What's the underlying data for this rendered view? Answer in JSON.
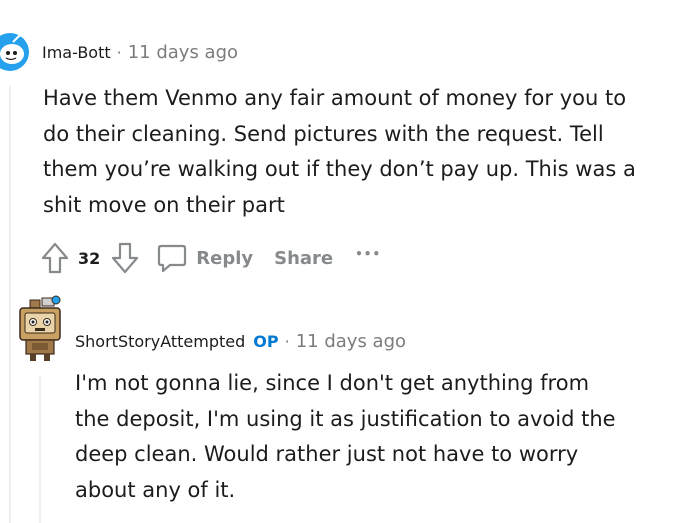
{
  "comment1": {
    "username": "Ima-Bott",
    "timestamp": "11 days ago",
    "body": "Have them Venmo any fair amount of money for you to do their cleaning. Send pictures with the request. Tell them you’re walking out if they don’t pay up. This was a shit move on their part",
    "votes": "32",
    "reply_label": "Reply",
    "share_label": "Share",
    "more_label": "•••"
  },
  "comment2": {
    "username": "ShortStoryAttempted",
    "badge": "OP",
    "timestamp": "11 days ago",
    "body": "I'm not gonna lie, since I don't get anything from the deposit, I'm using it as justification to avoid the deep clean. Would rather just not have to worry about any of it."
  },
  "separator": "·",
  "colors": {
    "text": "#1c1c1c",
    "meta": "#7c7c7c",
    "action": "#878a8c",
    "op_badge": "#0079d3",
    "thread_line": "#edeff1",
    "avatar_blue": "#24a0ed"
  }
}
